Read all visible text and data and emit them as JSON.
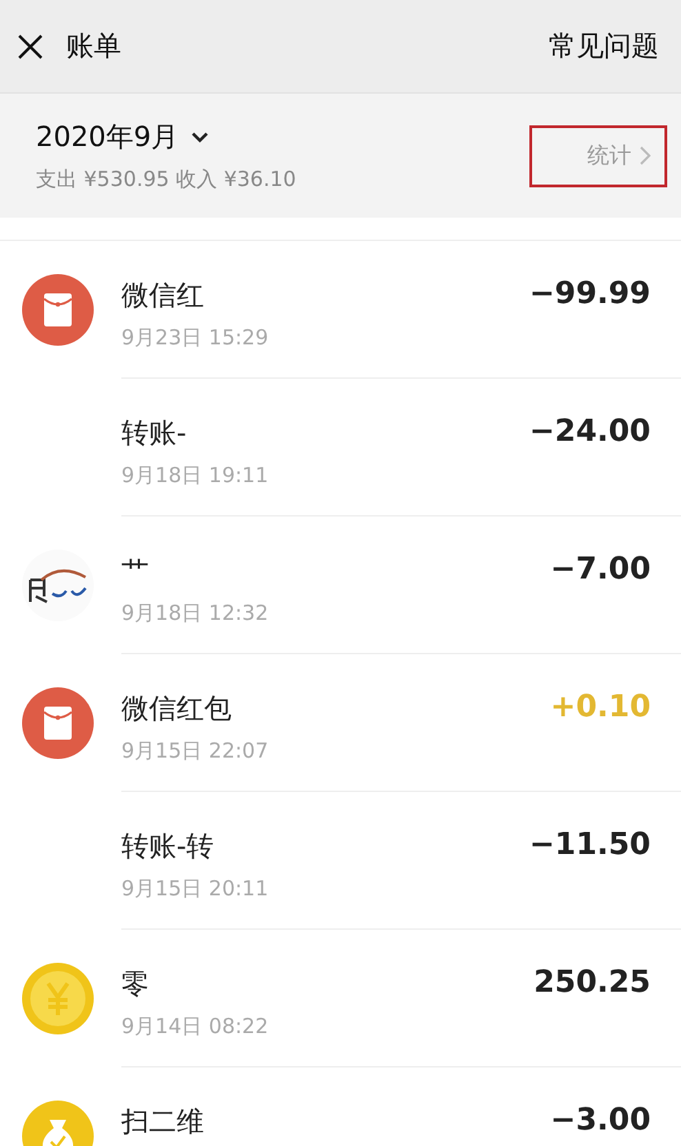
{
  "header": {
    "title": "账单",
    "help_link": "常见问题"
  },
  "summary": {
    "month": "2020年9月",
    "totals": "支出 ¥530.95 收入 ¥36.10",
    "stats_button": {
      "label": "统计",
      "highlighted": true
    }
  },
  "transactions": [
    {
      "kind": "red-packet",
      "title": "微信红",
      "time": "9月23日 15:29",
      "amount": "−99.99",
      "income": false
    },
    {
      "kind": "blank",
      "title": "转账-",
      "time": "9月18日 19:11",
      "amount": "−24.00",
      "income": false
    },
    {
      "kind": "logo",
      "title": "艹",
      "time": "9月18日 12:32",
      "amount": "−7.00",
      "income": false
    },
    {
      "kind": "red-packet",
      "title": "微信红包",
      "time": "9月15日 22:07",
      "amount": "+0.10",
      "income": true
    },
    {
      "kind": "blank",
      "title": "转账-转",
      "time": "9月15日 20:11",
      "amount": "−11.50",
      "income": false
    },
    {
      "kind": "coin",
      "title": "零",
      "time": "9月14日 08:22",
      "amount": "250.25",
      "income": false
    },
    {
      "kind": "money-bag",
      "title": "扫二维",
      "amount": "−3.00",
      "income": false
    }
  ]
}
